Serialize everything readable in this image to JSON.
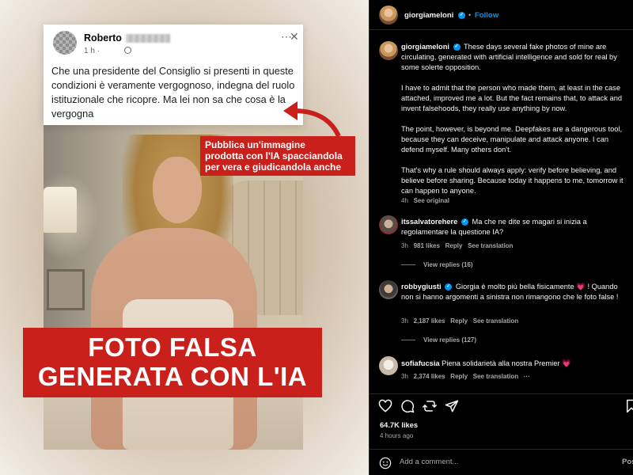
{
  "post_image": {
    "fb_card": {
      "name": "Roberto",
      "time": "1 h ·",
      "text": "Che una presidente del Consiglio  si presenti in queste condizioni è veramente vergognoso, indegna del ruolo istituzionale che ricopre. Ma lei non sa che cosa è la vergogna",
      "menu_icon": "ellipsis-icon",
      "close_icon": "close-icon"
    },
    "callout": {
      "line1": "Pubblica un'immagine",
      "line2": "prodotta con l'IA spacciandola",
      "line3": "per vera e giudicandola anche"
    },
    "headline": {
      "line1": "FOTO FALSA",
      "line2": "GENERATA CON L'IA"
    },
    "colors": {
      "accent_red": "#c9201b"
    }
  },
  "instagram": {
    "header": {
      "username": "giorgiameloni",
      "separator": "•",
      "follow_label": "Follow"
    },
    "caption": {
      "username": "giorgiameloni",
      "paragraphs": [
        "These days several fake photos of mine are circulating, generated with artificial intelligence and sold for real by some solerte opposition.",
        "I have to admit that the person who made them, at least in the case attached, improved me a lot. But the fact remains that, to attack and invent falsehoods, they really use anything by now.",
        "The point, however, is beyond me. Deepfakes are a dangerous tool, because they can deceive, manipulate and attack anyone. I can defend myself. Many others don't.",
        "That's why a rule should always apply: verify before believing, and believe before sharing. Because today it happens to me, tomorrow it can happen to anyone."
      ],
      "age": "4h",
      "see_original": "See original"
    },
    "comments": [
      {
        "username": "itssalvatorehere",
        "text": "Ma che ne dite se magari si inizia a regolamentare la questione IA?",
        "age": "3h",
        "likes": "981 likes",
        "reply": "Reply",
        "translate": "See translation",
        "view_replies": "View replies (16)"
      },
      {
        "username": "robbygiusti",
        "text_before_emoji": "Giorgia è molto più bella fisicamente",
        "emoji": "💗",
        "text_after_emoji": "! Quando non si hanno argomenti a sinistra non rimangono che le foto false !",
        "age": "3h",
        "likes": "2,187 likes",
        "reply": "Reply",
        "translate": "See translation",
        "view_replies": "View replies (127)"
      },
      {
        "username": "sofiafucsia",
        "text": "Piena solidarietà alla nostra Premier",
        "emoji": "💗",
        "age": "3h",
        "likes": "2,374 likes",
        "reply": "Reply",
        "translate": "See translation",
        "more": "···"
      }
    ],
    "actions": {
      "icons": [
        "heart-icon",
        "comment-icon",
        "share-icon",
        "send-icon",
        "bookmark-icon"
      ],
      "likes": "64.7K likes",
      "posted": "4 hours ago"
    },
    "comment_box": {
      "placeholder": "Add a comment...",
      "post_label": "Pos"
    },
    "colors": {
      "background": "#000000",
      "link_blue": "#0095f6",
      "muted": "#a8a8a8"
    }
  }
}
